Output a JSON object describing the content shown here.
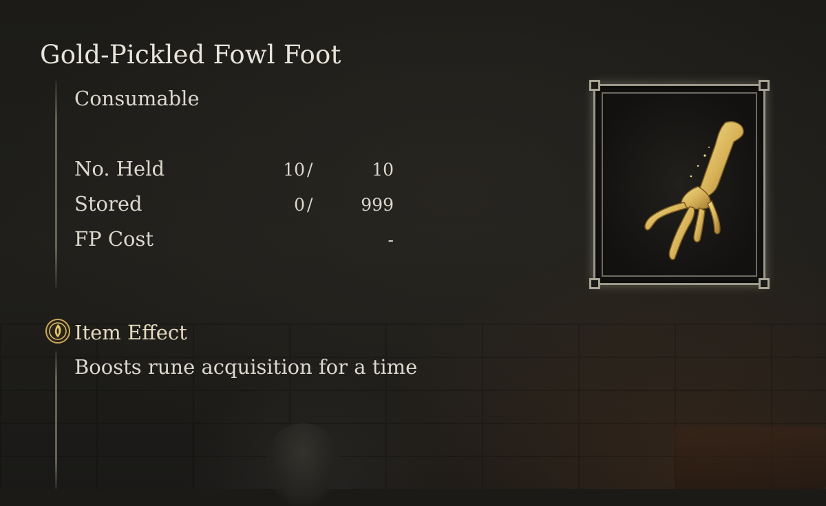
{
  "item": {
    "name": "Gold-Pickled Fowl Foot",
    "category": "Consumable",
    "image_icon": "fowl-foot-icon"
  },
  "stats": [
    {
      "label": "No. Held",
      "current": "10",
      "slash": "/",
      "max": "10"
    },
    {
      "label": "Stored",
      "current": "0",
      "slash": "/",
      "max": "999"
    },
    {
      "label": "FP Cost",
      "current": "",
      "slash": "",
      "max": "-"
    }
  ],
  "effect": {
    "title": "Item Effect",
    "icon": "item-effect-icon",
    "text": "Boosts rune acquisition for a time"
  },
  "colors": {
    "text": "#dcd8cd",
    "gold_accent": "#d9b45a",
    "frame": "#9b978a"
  }
}
